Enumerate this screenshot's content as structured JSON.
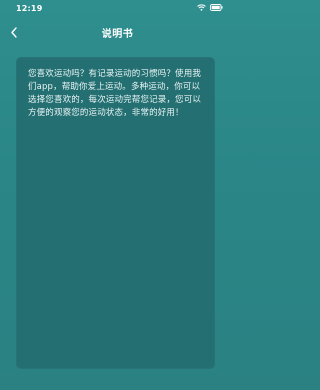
{
  "status_bar": {
    "time": "12:19",
    "icons": [
      "wifi-icon",
      "battery-icon"
    ]
  },
  "nav": {
    "back_icon": "chevron-left-icon",
    "title": "说明书"
  },
  "content": {
    "body": "您喜欢运动吗？有记录运动的习惯吗？使用我们app，帮助你爱上运动。多种运动，你可以选择您喜欢的，每次运动完帮您记录，您可以方便的观察您的运动状态，非常的好用！"
  },
  "colors": {
    "background": "#2b8788",
    "card": "#236f72",
    "text": "#e9f4f4"
  }
}
